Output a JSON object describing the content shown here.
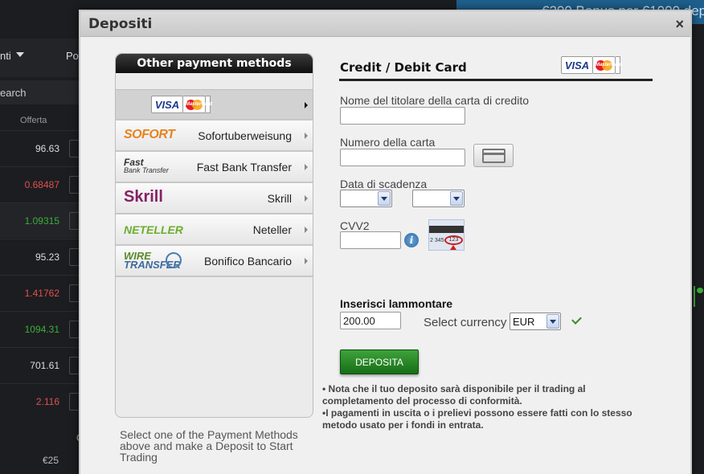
{
  "background": {
    "banner_text": "€200 Bonus per €1000 dep",
    "dropdown_label": "nti",
    "nav_label": "Po",
    "search_label": "earch",
    "column_header": "Offerta",
    "rows": [
      {
        "value": "96.63",
        "color": "#dddddd"
      },
      {
        "value": "0.68487",
        "color": "#e05050"
      },
      {
        "value": "1.09315",
        "color": "#3cae3c"
      },
      {
        "value": "95.23",
        "color": "#dddddd"
      },
      {
        "value": "1.41762",
        "color": "#e05050"
      },
      {
        "value": "1094.31",
        "color": "#3cae3c"
      },
      {
        "value": "701.61",
        "color": "#dddddd"
      },
      {
        "value": "2.116",
        "color": "#e05050"
      }
    ],
    "bottom_char": "C",
    "bottom_amount": "€25"
  },
  "modal": {
    "title": "Depositi",
    "close_label": "×"
  },
  "methods": {
    "header": "Other payment methods",
    "items": [
      {
        "label": "",
        "logo": "visa-mastercard-logo"
      },
      {
        "label": "Sofortuberweisung",
        "logo_text": "SOFORT"
      },
      {
        "label": "Fast Bank Transfer",
        "logo_text": "Fast",
        "logo_sub": "Bank Transfer"
      },
      {
        "label": "Skrill",
        "logo_text": "Skrill"
      },
      {
        "label": "Neteller",
        "logo_text": "NETELLER"
      },
      {
        "label": "Bonifico Bancario",
        "logo_text": "WIRE",
        "logo_sub": "TRANSFER"
      }
    ],
    "hint": "Select one of the Payment Methods above and make a Deposit to Start Trading"
  },
  "form": {
    "title": "Credit / Debit Card",
    "cardholder_label": "Nome del titolare della carta di credito",
    "cardholder_value": "",
    "card_number_label": "Numero della carta",
    "card_number_value": "",
    "expiry_label": "Data di scadenza",
    "expiry_month": "",
    "expiry_year": "",
    "cvv_label": "CVV2",
    "cvv_value": "",
    "cvv_example_number": "2 345",
    "cvv_example_code": "123",
    "amount_title": "Inserisci lammontare",
    "amount_value": "200.00",
    "currency_label": "Select currency",
    "currency_value": "EUR",
    "deposit_button": "DEPOSITA",
    "note_1": "• Nota che il tuo deposito sarà disponibile per il trading al completamento del processo di conformità.",
    "note_2": "•I pagamenti in uscita o i prelievi possono essere fatti con lo stesso metodo usato per i fondi in entrata."
  },
  "card_brands": {
    "visa": "VISA",
    "mastercard": "MasterCard"
  }
}
